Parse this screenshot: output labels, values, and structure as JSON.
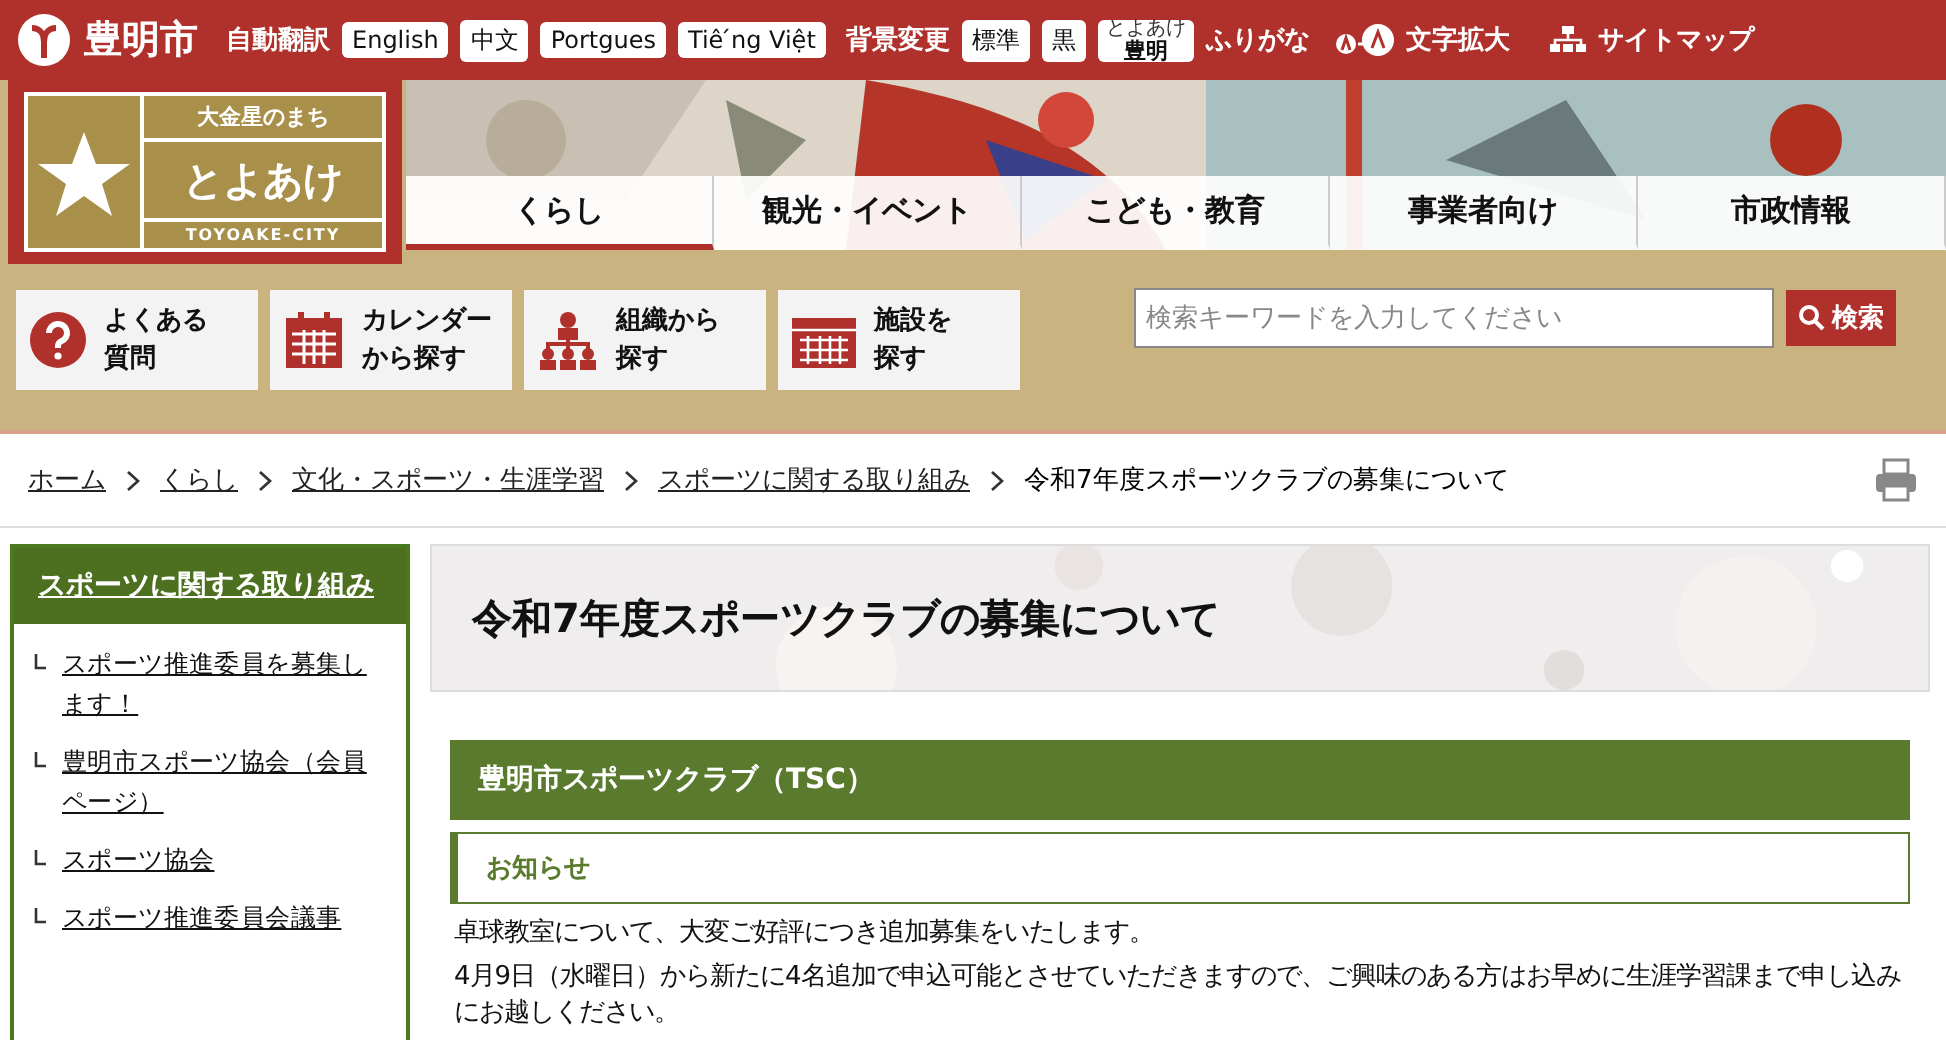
{
  "top_bar": {
    "site_name": "豊明市",
    "translate_label": "自動翻訳",
    "languages": [
      "English",
      "中文",
      "Portgues",
      "Tiê ́ng Việt"
    ],
    "background_label": "背景変更",
    "background_options": [
      "標準",
      "黒"
    ],
    "furigana_button": {
      "ruby": "とよあけ",
      "base": "豊明"
    },
    "furigana_label": "ふりがな",
    "font_size_label": "文字拡大",
    "sitemap_label": "サイトマップ"
  },
  "logo": {
    "tagline": "大金星のまち",
    "name": "とよあけ",
    "roman": "TOYOAKE-CITY"
  },
  "nav_tabs": [
    {
      "label": "くらし",
      "selected": true
    },
    {
      "label": "観光・イベント",
      "selected": false
    },
    {
      "label": "こども・教育",
      "selected": false
    },
    {
      "label": "事業者向け",
      "selected": false
    },
    {
      "label": "市政情報",
      "selected": false
    }
  ],
  "quick_links": [
    {
      "kind": "question",
      "lines": [
        "よくある",
        "質問"
      ]
    },
    {
      "kind": "calendar",
      "lines": [
        "カレンダー",
        "から探す"
      ]
    },
    {
      "kind": "org",
      "lines": [
        "組織から",
        "探す"
      ]
    },
    {
      "kind": "building",
      "lines": [
        "施設を",
        "探す"
      ]
    }
  ],
  "search": {
    "placeholder": "検索キーワードを入力してください",
    "button": "検索"
  },
  "breadcrumb": {
    "links": [
      "ホーム",
      "くらし",
      "文化・スポーツ・生涯学習",
      "スポーツに関する取り組み"
    ],
    "current": "令和7年度スポーツクラブの募集について"
  },
  "sidebar": {
    "title": "スポーツに関する取り組み",
    "items": [
      "スポーツ推進委員を募集します！",
      "豊明市スポーツ協会（会員ページ）",
      "スポーツ協会",
      "スポーツ推進委員会議事"
    ]
  },
  "page_title": "令和7年度スポーツクラブの募集について",
  "section_heading": "豊明市スポーツクラブ（TSC）",
  "subheading": "お知らせ",
  "paragraphs": [
    "卓球教室について、大変ご好評につき追加募集をいたします。",
    "4月9日（水曜日）から新たに4名追加で申込可能とさせていただきますので、ご興味のある方はお早めに生涯学習課まで申し込みにお越しください。"
  ]
}
